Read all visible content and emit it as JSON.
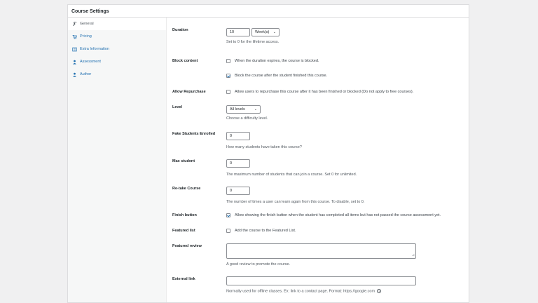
{
  "panel": {
    "title": "Course Settings"
  },
  "sidebar": {
    "items": [
      {
        "label": "General",
        "icon": "wrench-icon"
      },
      {
        "label": "Pricing",
        "icon": "cart-icon"
      },
      {
        "label": "Extra Information",
        "icon": "list-icon"
      },
      {
        "label": "Assessment",
        "icon": "person-icon"
      },
      {
        "label": "Author",
        "icon": "person-icon"
      }
    ]
  },
  "fields": {
    "duration": {
      "label": "Duration",
      "value": "10",
      "unit": "Week(s)",
      "desc": "Set to 0 for the lifetime access."
    },
    "block_content": {
      "label": "Block content",
      "option1": "When the duration expires, the course is blocked.",
      "option2": "Block the course after the student finished this course."
    },
    "allow_repurchase": {
      "label": "Allow Repurchase",
      "option": "Allow users to repurchase this course after it has been finished or blocked (Do not apply to free courses)."
    },
    "level": {
      "label": "Level",
      "value": "All levels",
      "desc": "Choose a difficulty level."
    },
    "fake_students": {
      "label": "Fake Students Enrolled",
      "value": "0",
      "desc": "How many students have taken this course?"
    },
    "max_student": {
      "label": "Max student",
      "value": "0",
      "desc": "The maximum number of students that can join a course. Set 0 for unlimited."
    },
    "retake": {
      "label": "Re-take Course",
      "value": "0",
      "desc": "The number of times a user can learn again from this course. To disable, set to 0."
    },
    "finish_button": {
      "label": "Finish button",
      "option": "Allow showing the finish button when the student has completed all items but has not passed the course assessment yet."
    },
    "featured_list": {
      "label": "Featured list",
      "option": "Add the course to the Featured List."
    },
    "featured_review": {
      "label": "Featured review",
      "desc": "A good review to promote the course."
    },
    "external_link": {
      "label": "External link",
      "desc": "Normally used for offline classes. Ex: link to a contact page. Format: https://google.com"
    }
  },
  "colors": {
    "accent": "#2271b1",
    "sidebar_bg": "#f6f7f7",
    "border": "#dcdcde"
  }
}
